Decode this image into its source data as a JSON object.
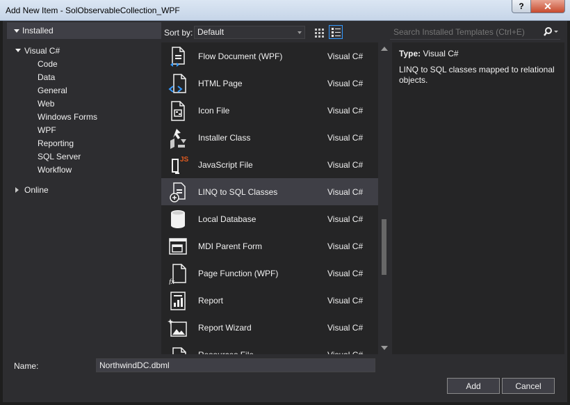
{
  "window": {
    "title": "Add New Item - SolObservableCollection_WPF",
    "help_label": "?",
    "close_label": "✕"
  },
  "tree": {
    "installed_label": "Installed",
    "visual_csharp_label": "Visual C#",
    "children": [
      "Code",
      "Data",
      "General",
      "Web",
      "Windows Forms",
      "WPF",
      "Reporting",
      "SQL Server",
      "Workflow"
    ],
    "online_label": "Online"
  },
  "toolbar": {
    "sort_label": "Sort by:",
    "sort_value": "Default",
    "search_placeholder": "Search Installed Templates (Ctrl+E)"
  },
  "templates": [
    {
      "name": "Flow Document (WPF)",
      "type": "Visual C#",
      "icon": "flow-document-icon"
    },
    {
      "name": "HTML Page",
      "type": "Visual C#",
      "icon": "html-page-icon"
    },
    {
      "name": "Icon File",
      "type": "Visual C#",
      "icon": "icon-file-icon"
    },
    {
      "name": "Installer Class",
      "type": "Visual C#",
      "icon": "installer-class-icon"
    },
    {
      "name": "JavaScript File",
      "type": "Visual C#",
      "icon": "javascript-file-icon"
    },
    {
      "name": "LINQ to SQL Classes",
      "type": "Visual C#",
      "icon": "linq-to-sql-icon",
      "selected": true
    },
    {
      "name": "Local Database",
      "type": "Visual C#",
      "icon": "database-icon"
    },
    {
      "name": "MDI Parent Form",
      "type": "Visual C#",
      "icon": "mdi-form-icon"
    },
    {
      "name": "Page Function (WPF)",
      "type": "Visual C#",
      "icon": "page-function-icon"
    },
    {
      "name": "Report",
      "type": "Visual C#",
      "icon": "report-icon"
    },
    {
      "name": "Report Wizard",
      "type": "Visual C#",
      "icon": "report-wizard-icon"
    },
    {
      "name": "Resources File",
      "type": "Visual C#",
      "icon": "resources-file-icon"
    }
  ],
  "details": {
    "type_label": "Type:",
    "type_value": "Visual C#",
    "description": "LINQ to SQL classes mapped to relational objects."
  },
  "footer": {
    "name_label": "Name:",
    "name_value": "NorthwindDC.dbml",
    "add_label": "Add",
    "cancel_label": "Cancel"
  }
}
